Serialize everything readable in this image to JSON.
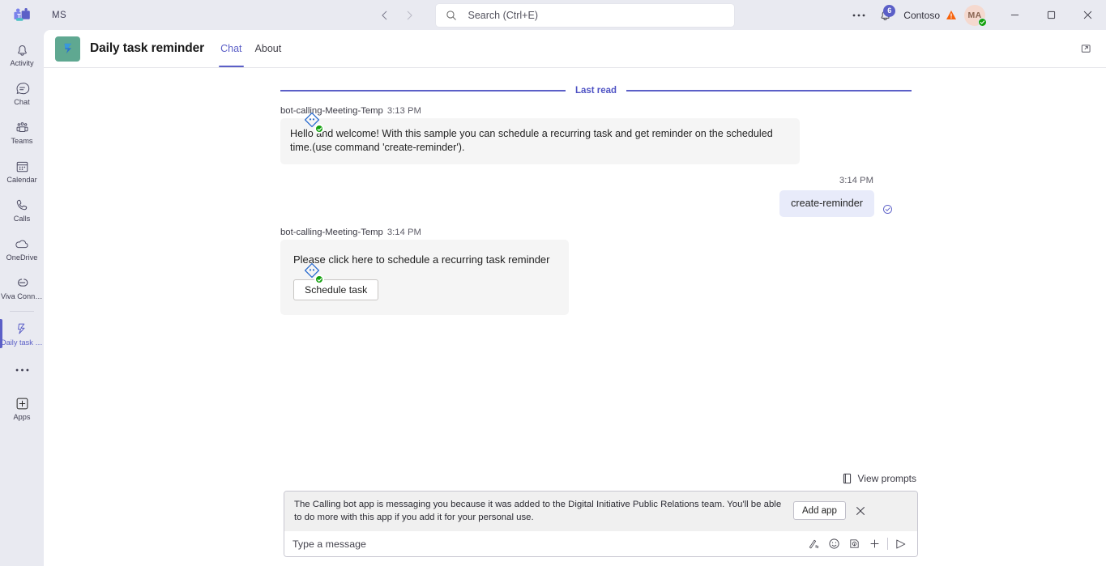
{
  "titlebar": {
    "app_logo": "teams-logo",
    "tenant_initials": "MS",
    "back_icon": "chevron-left-icon",
    "forward_icon": "chevron-right-icon",
    "search": {
      "placeholder": "Search (Ctrl+E)",
      "value": "",
      "icon": "search-icon"
    },
    "more_icon": "ellipsis-icon",
    "notifications": {
      "icon": "bell-icon",
      "badge_count": "6"
    },
    "tenant_name": "Contoso",
    "warning_icon": "warning-triangle-icon",
    "account": {
      "initials": "MA",
      "presence": "available",
      "presence_color": "#13a10e"
    },
    "window_controls": {
      "minimize": "minimize-icon",
      "maximize": "restore-icon",
      "close": "close-icon"
    }
  },
  "rail": {
    "items": [
      {
        "label": "Activity",
        "icon": "bell-icon",
        "active": false
      },
      {
        "label": "Chat",
        "icon": "chat-bubble-icon",
        "active": false
      },
      {
        "label": "Teams",
        "icon": "teams-people-icon",
        "active": false
      },
      {
        "label": "Calendar",
        "icon": "calendar-icon",
        "active": false
      },
      {
        "label": "Calls",
        "icon": "phone-icon",
        "active": false
      },
      {
        "label": "OneDrive",
        "icon": "cloud-icon",
        "active": false
      },
      {
        "label": "Viva Conne...",
        "icon": "viva-connections-icon",
        "active": false
      },
      {
        "label": "Daily task r...",
        "icon": "daily-task-reminder-app-icon",
        "active": true
      }
    ],
    "more_label": "···",
    "apps_label": "Apps",
    "apps_icon": "plus-box-icon"
  },
  "app_header": {
    "logo_icon": "power-automate-flag-icon",
    "logo_bg": "#5fa891",
    "title": "Daily task reminder",
    "tabs": [
      {
        "label": "Chat",
        "active": true
      },
      {
        "label": "About",
        "active": false
      }
    ],
    "popout_icon": "open-in-new-window-icon"
  },
  "chat": {
    "divider_label": "Last read",
    "divider_color": "#5b5fc7",
    "messages": [
      {
        "direction": "incoming",
        "sender": "bot-calling-Meeting-Temp",
        "time": "3:13 PM",
        "type": "text",
        "text": "Hello and welcome! With this sample you can schedule a recurring task and get reminder on the scheduled time.(use command 'create-reminder')."
      },
      {
        "direction": "outgoing",
        "time": "3:14 PM",
        "type": "text",
        "text": "create-reminder",
        "status_icon": "delivered-check-icon"
      },
      {
        "direction": "incoming",
        "sender": "bot-calling-Meeting-Temp",
        "time": "3:14 PM",
        "type": "card",
        "card_text": "Please click here to schedule a recurring task reminder",
        "card_button": "Schedule task"
      }
    ]
  },
  "compose": {
    "view_prompts_label": "View prompts",
    "view_prompts_icon": "prompt-book-icon",
    "notice_text": "The Calling bot app is messaging you because it was added to the Digital Initiative Public Relations team. You'll be able to do more with this app if you add it for your personal use.",
    "add_app_label": "Add app",
    "close_icon": "close-icon",
    "input_placeholder": "Type a message",
    "input_value": "",
    "icons": [
      {
        "name": "format-text-icon"
      },
      {
        "name": "emoji-icon"
      },
      {
        "name": "giphy-icon"
      },
      {
        "name": "plus-more-icon"
      },
      {
        "name": "send-icon"
      }
    ]
  }
}
